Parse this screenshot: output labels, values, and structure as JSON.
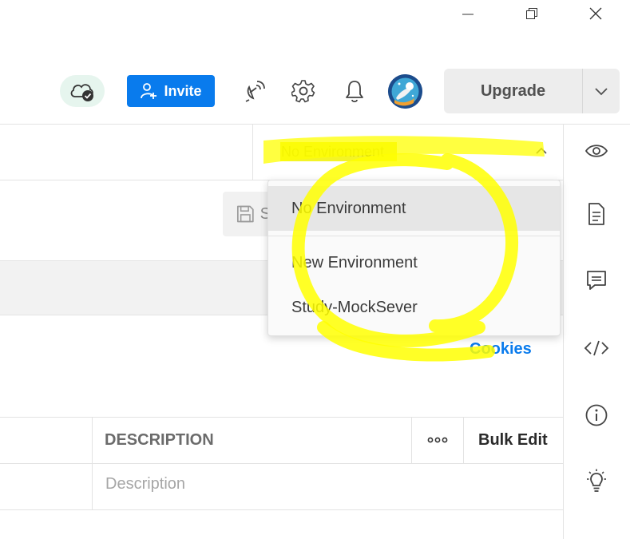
{
  "window": {
    "controls": [
      "minimize-icon",
      "restore-icon",
      "close-icon"
    ]
  },
  "header": {
    "sync_icon": "cloud-check-icon",
    "invite_label": "Invite",
    "icons": [
      "satellite-icon",
      "gear-icon",
      "bell-icon"
    ],
    "upgrade_label": "Upgrade"
  },
  "environment": {
    "selected": "No Environment",
    "options": [
      "No Environment",
      "New Environment",
      "Study-MockSever"
    ]
  },
  "request": {
    "save_label": "S"
  },
  "cookies_label": "Cookies",
  "params_table": {
    "columns": [
      "DESCRIPTION"
    ],
    "more_label": "ooo",
    "bulk_edit_label": "Bulk Edit",
    "description_placeholder": "Description"
  },
  "right_sidebar": {
    "icons": [
      "eye-icon",
      "document-icon",
      "comment-icon",
      "code-icon",
      "info-icon",
      "lightbulb-icon"
    ]
  },
  "colors": {
    "accent": "#097bed",
    "highlight": "#ffff00"
  }
}
